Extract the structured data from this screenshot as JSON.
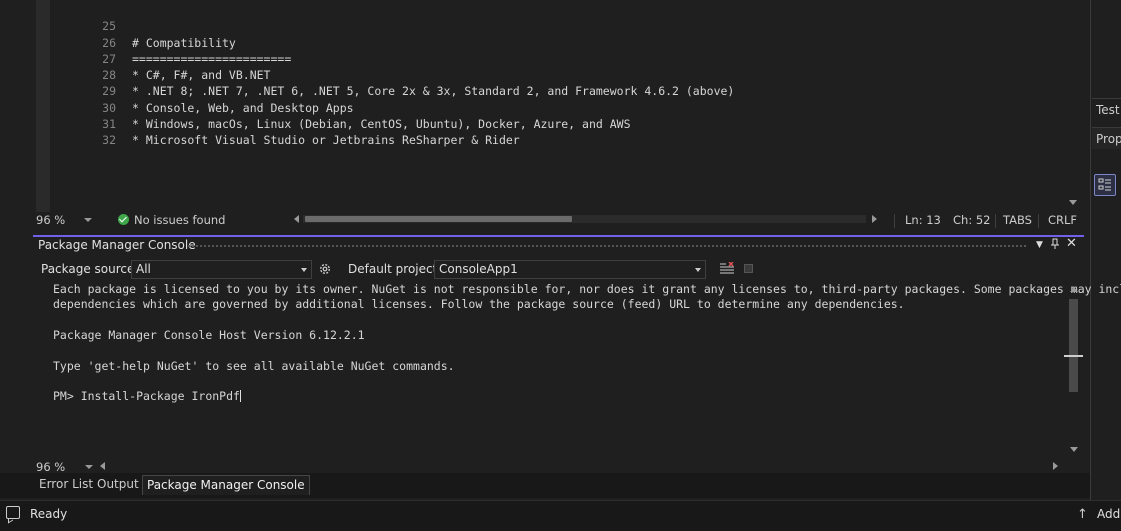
{
  "editor": {
    "lines": [
      {
        "n": "25",
        "text": "# Compatibility"
      },
      {
        "n": "26",
        "text": "======================="
      },
      {
        "n": "27",
        "text": "* C#, F#, and VB.NET"
      },
      {
        "n": "28",
        "text": "* .NET 8; .NET 7, .NET 6, .NET 5, Core 2x & 3x, Standard 2, and Framework 4.6.2 (above)"
      },
      {
        "n": "29",
        "text": "* Console, Web, and Desktop Apps"
      },
      {
        "n": "30",
        "text": "* Windows, macOs, Linux (Debian, CentOS, Ubuntu), Docker, Azure, and AWS"
      },
      {
        "n": "31",
        "text": "* Microsoft Visual Studio or Jetbrains ReSharper & Rider"
      },
      {
        "n": "32",
        "text": ""
      }
    ],
    "status": {
      "zoom": "96 %",
      "issues": "No issues found",
      "line": "Ln: 13",
      "col": "Ch: 52",
      "indent": "TABS",
      "eol": "CRLF"
    }
  },
  "side_panel": {
    "tab1": "Test",
    "tab2": "Prop"
  },
  "pmc": {
    "title": "Package Manager Console",
    "package_source_label": "Package source:",
    "package_source_value": "All",
    "default_project_label": "Default project:",
    "default_project_value": "ConsoleApp1",
    "output": [
      "Each package is licensed to you by its owner. NuGet is not responsible for, nor does it grant any licenses to, third-party packages. Some packages may include",
      "dependencies which are governed by additional licenses. Follow the package source (feed) URL to determine any dependencies.",
      "",
      "Package Manager Console Host Version 6.12.2.1",
      "",
      "Type 'get-help NuGet' to see all available NuGet commands.",
      "",
      "PM> Install-Package IronPdf"
    ],
    "zoom": "96 %"
  },
  "bottom_tabs": [
    {
      "label": "Error List"
    },
    {
      "label": "Output"
    },
    {
      "label": "Package Manager Console",
      "active": true
    }
  ],
  "statusbar": {
    "ready": "Ready",
    "add": "Add"
  },
  "colors": {
    "accent": "#7160e8",
    "ok": "#3fa74a",
    "background": "#1f1f1f"
  }
}
